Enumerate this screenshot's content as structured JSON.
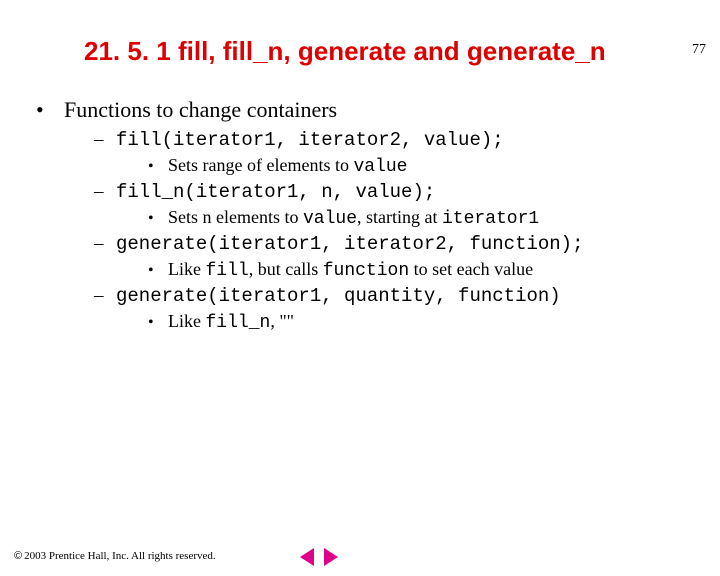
{
  "pageNumber": "77",
  "title": "21. 5. 1 fill, fill_n, generate and generate_n",
  "b1": "Functions to change containers",
  "i1_code": "fill(iterator1, iterator2, value);",
  "i1_sub_a": "Sets range of elements to ",
  "i1_sub_b": "value",
  "i2_code": "fill_n(iterator1, n, value);",
  "i2_sub_a": "Sets n elements to ",
  "i2_sub_b": "value",
  "i2_sub_c": ", starting at ",
  "i2_sub_d": "iterator1",
  "i3_code": "generate(iterator1, iterator2, function);",
  "i3_sub_a": "Like ",
  "i3_sub_b": "fill",
  "i3_sub_c": ", but calls ",
  "i3_sub_d": "function",
  "i3_sub_e": " to set each value",
  "i4_code": "generate(iterator1, quantity, function)",
  "i4_sub_a": "Like ",
  "i4_sub_b": "fill_n",
  "i4_sub_c": ", \"\"",
  "footer_sym": "©",
  "footer_text": " 2003 Prentice Hall, Inc. All rights reserved."
}
